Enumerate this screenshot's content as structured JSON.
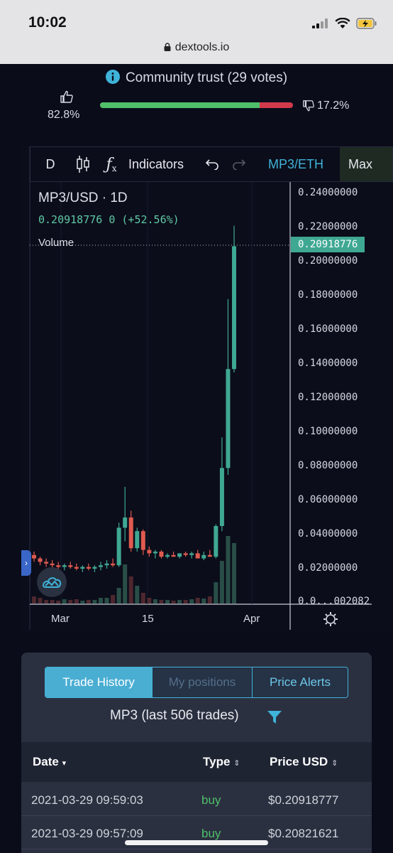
{
  "status": {
    "time": "10:02",
    "url": "dextools.io"
  },
  "trust": {
    "title": "Community trust (29 votes)",
    "up_pct": "82.8%",
    "down_pct": "17.2%",
    "up_fraction": 0.828,
    "colors": {
      "up": "#4fbf6a",
      "down": "#d23a4c"
    }
  },
  "toolbar": {
    "interval": "D",
    "indicators": "Indicators",
    "pair": "MP3/ETH",
    "max": "Max"
  },
  "chart_header": {
    "symbol": "MP3/USD · 1D",
    "price_line": "0.20918776 0 (+52.56%)",
    "volume_label": "Volume",
    "last_price": "0.20918776"
  },
  "chart_data": {
    "type": "candlestick",
    "title": "MP3/USD · 1D",
    "y_ticks": [
      "0.24000000",
      "0.22000000",
      "0.20000000",
      "0.18000000",
      "0.16000000",
      "0.14000000",
      "0.12000000",
      "0.10000000",
      "0.08000000",
      "0.06000000",
      "0.04000000",
      "0.02000000",
      "0.0...002082"
    ],
    "x_ticks": [
      "Mar",
      "15",
      "Apr"
    ],
    "ylim": [
      0,
      0.24
    ],
    "colors": {
      "up": "#3fa893",
      "down": "#e05a4f"
    },
    "candles": [
      {
        "o": 0.028,
        "h": 0.03,
        "l": 0.024,
        "c": 0.026
      },
      {
        "o": 0.026,
        "h": 0.027,
        "l": 0.022,
        "c": 0.024
      },
      {
        "o": 0.024,
        "h": 0.026,
        "l": 0.021,
        "c": 0.023
      },
      {
        "o": 0.023,
        "h": 0.025,
        "l": 0.02,
        "c": 0.022
      },
      {
        "o": 0.022,
        "h": 0.024,
        "l": 0.019,
        "c": 0.021
      },
      {
        "o": 0.021,
        "h": 0.023,
        "l": 0.019,
        "c": 0.022
      },
      {
        "o": 0.022,
        "h": 0.024,
        "l": 0.02,
        "c": 0.021
      },
      {
        "o": 0.021,
        "h": 0.023,
        "l": 0.019,
        "c": 0.02
      },
      {
        "o": 0.02,
        "h": 0.022,
        "l": 0.018,
        "c": 0.021
      },
      {
        "o": 0.021,
        "h": 0.023,
        "l": 0.019,
        "c": 0.02
      },
      {
        "o": 0.02,
        "h": 0.022,
        "l": 0.018,
        "c": 0.021
      },
      {
        "o": 0.021,
        "h": 0.024,
        "l": 0.019,
        "c": 0.022
      },
      {
        "o": 0.022,
        "h": 0.025,
        "l": 0.02,
        "c": 0.023
      },
      {
        "o": 0.023,
        "h": 0.026,
        "l": 0.021,
        "c": 0.022
      },
      {
        "o": 0.022,
        "h": 0.047,
        "l": 0.021,
        "c": 0.044
      },
      {
        "o": 0.044,
        "h": 0.068,
        "l": 0.036,
        "c": 0.05
      },
      {
        "o": 0.05,
        "h": 0.054,
        "l": 0.03,
        "c": 0.032
      },
      {
        "o": 0.032,
        "h": 0.044,
        "l": 0.03,
        "c": 0.042
      },
      {
        "o": 0.042,
        "h": 0.043,
        "l": 0.028,
        "c": 0.031
      },
      {
        "o": 0.031,
        "h": 0.033,
        "l": 0.027,
        "c": 0.029
      },
      {
        "o": 0.029,
        "h": 0.031,
        "l": 0.026,
        "c": 0.03
      },
      {
        "o": 0.03,
        "h": 0.031,
        "l": 0.026,
        "c": 0.027
      },
      {
        "o": 0.027,
        "h": 0.029,
        "l": 0.026,
        "c": 0.028
      },
      {
        "o": 0.028,
        "h": 0.03,
        "l": 0.027,
        "c": 0.027
      },
      {
        "o": 0.027,
        "h": 0.029,
        "l": 0.026,
        "c": 0.029
      },
      {
        "o": 0.029,
        "h": 0.03,
        "l": 0.027,
        "c": 0.028
      },
      {
        "o": 0.028,
        "h": 0.03,
        "l": 0.026,
        "c": 0.029
      },
      {
        "o": 0.029,
        "h": 0.031,
        "l": 0.027,
        "c": 0.026
      },
      {
        "o": 0.026,
        "h": 0.03,
        "l": 0.025,
        "c": 0.028
      },
      {
        "o": 0.028,
        "h": 0.031,
        "l": 0.027,
        "c": 0.027
      },
      {
        "o": 0.027,
        "h": 0.046,
        "l": 0.026,
        "c": 0.045
      },
      {
        "o": 0.045,
        "h": 0.097,
        "l": 0.042,
        "c": 0.079
      },
      {
        "o": 0.079,
        "h": 0.178,
        "l": 0.075,
        "c": 0.137
      },
      {
        "o": 0.137,
        "h": 0.221,
        "l": 0.135,
        "c": 0.209
      }
    ],
    "volumes": [
      0.1,
      0.08,
      0.05,
      0.05,
      0.04,
      0.06,
      0.05,
      0.06,
      0.04,
      0.05,
      0.05,
      0.08,
      0.08,
      0.12,
      0.22,
      0.55,
      0.38,
      0.25,
      0.15,
      0.08,
      0.06,
      0.05,
      0.05,
      0.04,
      0.05,
      0.05,
      0.06,
      0.08,
      0.07,
      0.1,
      0.3,
      0.6,
      0.95,
      0.85
    ]
  },
  "trades": {
    "tabs": [
      "Trade History",
      "My positions",
      "Price Alerts"
    ],
    "title": "MP3 (last 506 trades)",
    "columns": [
      "Date",
      "Type",
      "Price USD"
    ],
    "rows": [
      {
        "date": "2021-03-29 09:59:03",
        "type": "buy",
        "price": "$0.20918777"
      },
      {
        "date": "2021-03-29 09:57:09",
        "type": "buy",
        "price": "$0.20821621"
      }
    ]
  }
}
